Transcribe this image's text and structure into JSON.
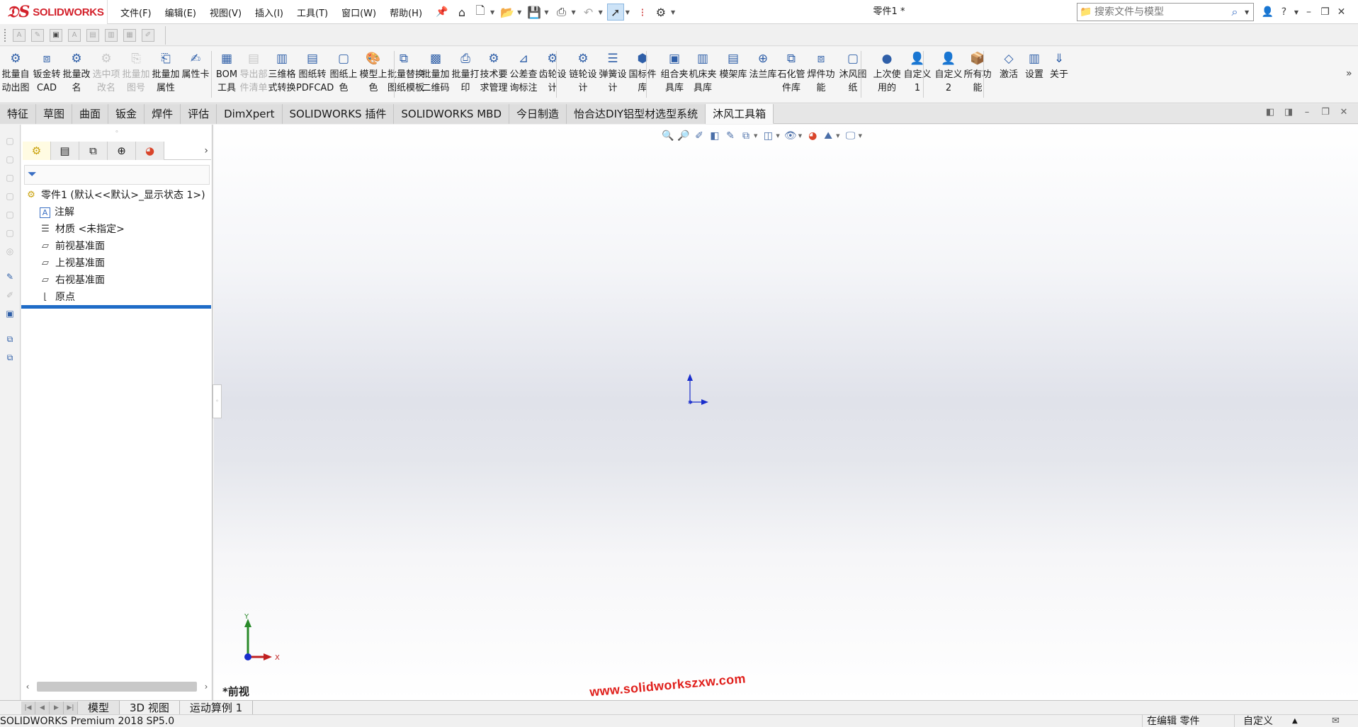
{
  "app": {
    "logo_text": "SOLIDWORKS",
    "document_title": "零件1 *"
  },
  "menu": [
    {
      "label": "文件(F)"
    },
    {
      "label": "编辑(E)"
    },
    {
      "label": "视图(V)"
    },
    {
      "label": "插入(I)"
    },
    {
      "label": "工具(T)"
    },
    {
      "label": "窗口(W)"
    },
    {
      "label": "帮助(H)"
    }
  ],
  "quick_access_icons": [
    "home-icon",
    "new-document-icon",
    "open-icon",
    "save-icon",
    "print-icon",
    "undo-icon",
    "select-icon",
    "traffic-light-icon",
    "options-gear-icon"
  ],
  "search": {
    "placeholder": "搜索文件与模型"
  },
  "command_manager": [
    {
      "l1": "批量自",
      "l2": "动出图",
      "icon": "batch-drawing-icon",
      "enabled": true
    },
    {
      "l1": "钣金转",
      "l2": "CAD",
      "icon": "sheetmetal-cad-icon",
      "enabled": true
    },
    {
      "l1": "批量改",
      "l2": "名",
      "icon": "batch-rename-icon",
      "enabled": true
    },
    {
      "l1": "选中项",
      "l2": "改名",
      "icon": "rename-selected-icon",
      "enabled": false
    },
    {
      "l1": "批量加",
      "l2": "图号",
      "icon": "add-drawing-number-icon",
      "enabled": false
    },
    {
      "l1": "批量加",
      "l2": "属性",
      "icon": "add-property-icon",
      "enabled": true
    },
    {
      "l1": "属性卡",
      "l2": "",
      "icon": "property-card-icon",
      "enabled": true
    },
    {
      "l1": "BOM",
      "l2": "工具",
      "icon": "bom-icon",
      "enabled": true
    },
    {
      "l1": "导出部",
      "l2": "件清单",
      "icon": "export-parts-list-icon",
      "enabled": false
    },
    {
      "l1": "三维格",
      "l2": "式转换",
      "icon": "3d-format-convert-icon",
      "enabled": true
    },
    {
      "l1": "图纸转",
      "l2": "PDFCAD",
      "icon": "drawing-pdf-icon",
      "enabled": true
    },
    {
      "l1": "图纸上",
      "l2": "色",
      "icon": "drawing-color-icon",
      "enabled": true
    },
    {
      "l1": "模型上",
      "l2": "色",
      "icon": "model-color-icon",
      "enabled": true
    },
    {
      "l1": "批量替换",
      "l2": "图纸模板",
      "icon": "replace-template-icon",
      "enabled": true
    },
    {
      "l1": "批量加",
      "l2": "二维码",
      "icon": "qr-code-icon",
      "enabled": true
    },
    {
      "l1": "批量打",
      "l2": "印",
      "icon": "batch-print-icon",
      "enabled": true
    },
    {
      "l1": "技术要",
      "l2": "求管理",
      "icon": "tech-requirements-icon",
      "enabled": true
    },
    {
      "l1": "公差查",
      "l2": "询标注",
      "icon": "tolerance-icon",
      "enabled": true
    },
    {
      "l1": "齿轮设",
      "l2": "计",
      "icon": "gear-design-icon",
      "enabled": true
    },
    {
      "l1": "链轮设",
      "l2": "计",
      "icon": "sprocket-design-icon",
      "enabled": true
    },
    {
      "l1": "弹簧设",
      "l2": "计",
      "icon": "spring-design-icon",
      "enabled": true
    },
    {
      "l1": "国标件",
      "l2": "库",
      "icon": "standard-parts-icon",
      "enabled": true
    },
    {
      "l1": "组合夹",
      "l2": "具库",
      "icon": "modular-fixture-icon",
      "enabled": true
    },
    {
      "l1": "机床夹",
      "l2": "具库",
      "icon": "machine-fixture-icon",
      "enabled": true
    },
    {
      "l1": "模架库",
      "l2": "",
      "icon": "mold-base-icon",
      "enabled": true
    },
    {
      "l1": "法兰库",
      "l2": "",
      "icon": "flange-icon",
      "enabled": true
    },
    {
      "l1": "石化管",
      "l2": "件库",
      "icon": "pipe-parts-icon",
      "enabled": true
    },
    {
      "l1": "焊件功",
      "l2": "能",
      "icon": "weldment-icon",
      "enabled": true
    },
    {
      "l1": "沐风图",
      "l2": "纸",
      "icon": "mufeng-drawing-icon",
      "enabled": true
    },
    {
      "l1": "上次使",
      "l2": "用的",
      "icon": "last-used-icon",
      "enabled": true
    },
    {
      "l1": "自定义",
      "l2": "1",
      "icon": "custom-user-icon",
      "enabled": true
    },
    {
      "l1": "自定义",
      "l2": "2",
      "icon": "custom-user-icon",
      "enabled": true
    },
    {
      "l1": "所有功",
      "l2": "能",
      "icon": "all-features-icon",
      "enabled": true
    },
    {
      "l1": "激活",
      "l2": "",
      "icon": "activate-diamond-icon",
      "enabled": true
    },
    {
      "l1": "设置",
      "l2": "",
      "icon": "settings-icon",
      "enabled": true
    },
    {
      "l1": "关于",
      "l2": "",
      "icon": "about-icon",
      "enabled": true
    }
  ],
  "tabs": [
    {
      "label": "特征"
    },
    {
      "label": "草图"
    },
    {
      "label": "曲面"
    },
    {
      "label": "钣金"
    },
    {
      "label": "焊件"
    },
    {
      "label": "评估"
    },
    {
      "label": "DimXpert"
    },
    {
      "label": "SOLIDWORKS 插件"
    },
    {
      "label": "SOLIDWORKS MBD"
    },
    {
      "label": "今日制造"
    },
    {
      "label": "怡合达DIY铝型材选型系统"
    },
    {
      "label": "沐风工具箱"
    }
  ],
  "active_tab": "沐风工具箱",
  "feature_tree": {
    "root": "零件1  (默认<<默认>_显示状态 1>)",
    "items": [
      {
        "label": "注解",
        "icon": "annotations-icon"
      },
      {
        "label": "材质 <未指定>",
        "icon": "material-icon"
      },
      {
        "label": "前视基准面",
        "icon": "plane-icon"
      },
      {
        "label": "上视基准面",
        "icon": "plane-icon"
      },
      {
        "label": "右视基准面",
        "icon": "plane-icon"
      },
      {
        "label": "原点",
        "icon": "origin-icon"
      }
    ]
  },
  "viewport": {
    "view_name": "*前视",
    "watermark": "www.solidworkszxw.com",
    "triad_x": "X",
    "triad_y": "Y"
  },
  "bottom_tabs": [
    {
      "label": "模型"
    },
    {
      "label": "3D 视图"
    },
    {
      "label": "运动算例 1"
    }
  ],
  "status": {
    "app_version": "SOLIDWORKS Premium 2018 SP5.0",
    "edit_mode": "在编辑 零件",
    "units": "自定义"
  }
}
